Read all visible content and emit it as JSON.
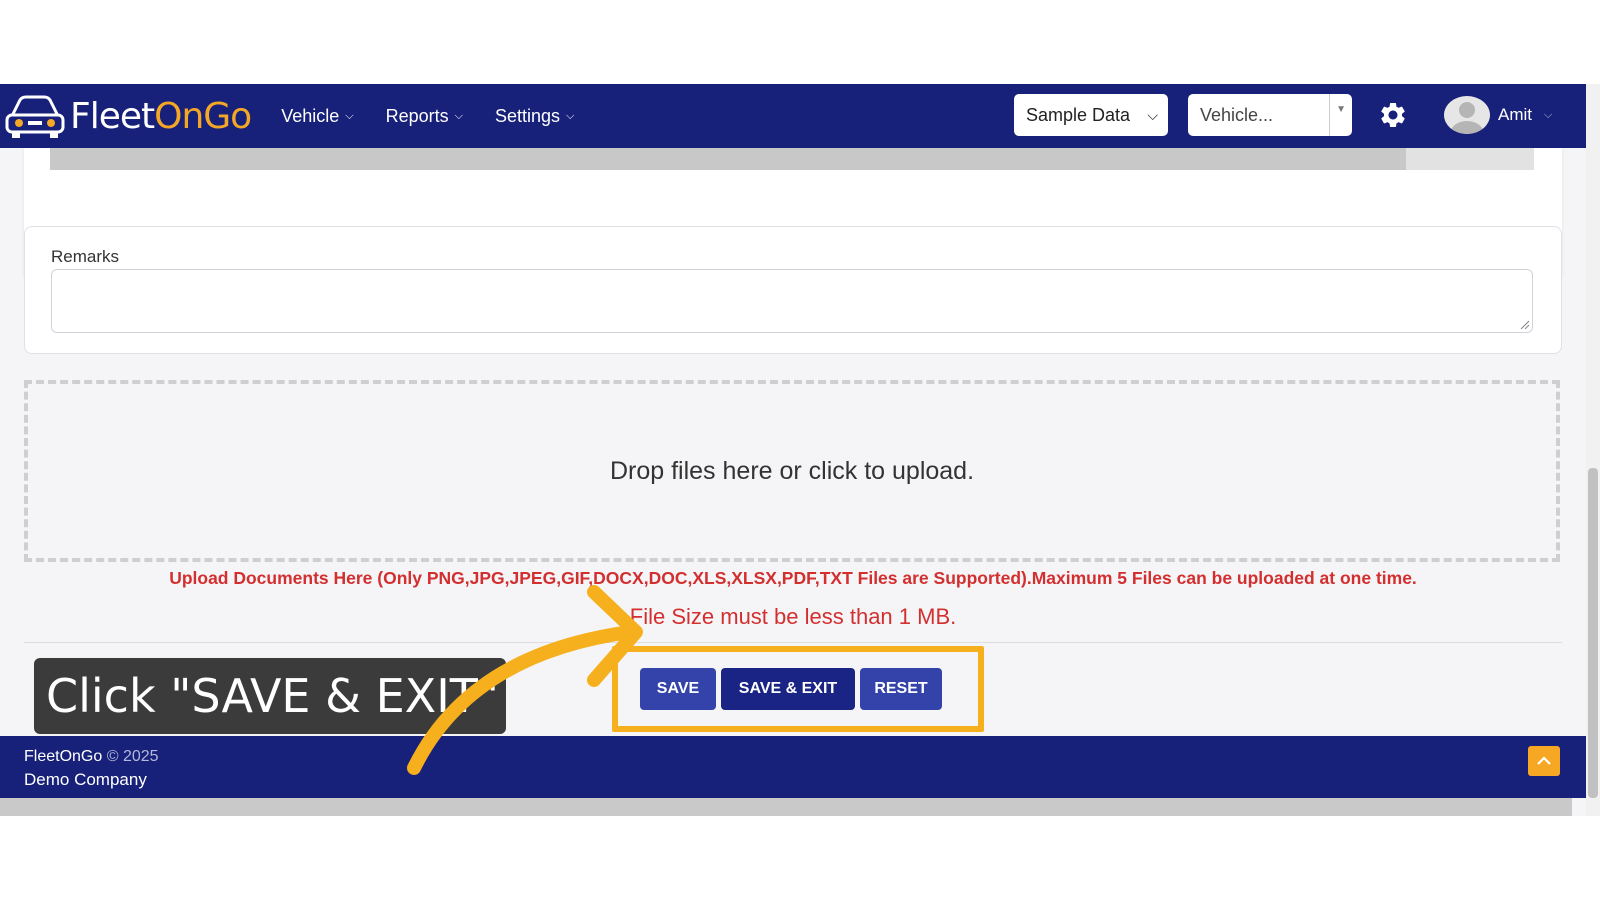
{
  "brand": {
    "logo_part1": "Fleet",
    "logo_part2": "On",
    "logo_part3": "Go"
  },
  "nav": [
    {
      "label": "Vehicle"
    },
    {
      "label": "Reports"
    },
    {
      "label": "Settings"
    }
  ],
  "header": {
    "sample_select": "Sample Data",
    "vehicle_select": "Vehicle...",
    "user_name": "Amit"
  },
  "form": {
    "remarks_label": "Remarks",
    "remarks_value": "",
    "dropzone_text": "Drop files here or click to upload.",
    "upload_note": "Upload Documents Here (Only PNG,JPG,JPEG,GIF,DOCX,DOC,XLS,XLSX,PDF,TXT Files are Supported).Maximum 5 Files can be uploaded at one time.",
    "size_note": "File Size must be less than 1 MB."
  },
  "buttons": {
    "save": "SAVE",
    "save_exit": "SAVE & EXIT",
    "reset": "RESET"
  },
  "callout": {
    "text": "Click \"SAVE & EXIT\""
  },
  "footer": {
    "brand": "FleetOnGo",
    "copyright": " © 2025",
    "company": "Demo Company"
  },
  "colors": {
    "navbar": "#17217a",
    "accent": "#f6b01e",
    "button": "#3343a9",
    "button_primary": "#1a2485",
    "error": "#d32f2f"
  }
}
